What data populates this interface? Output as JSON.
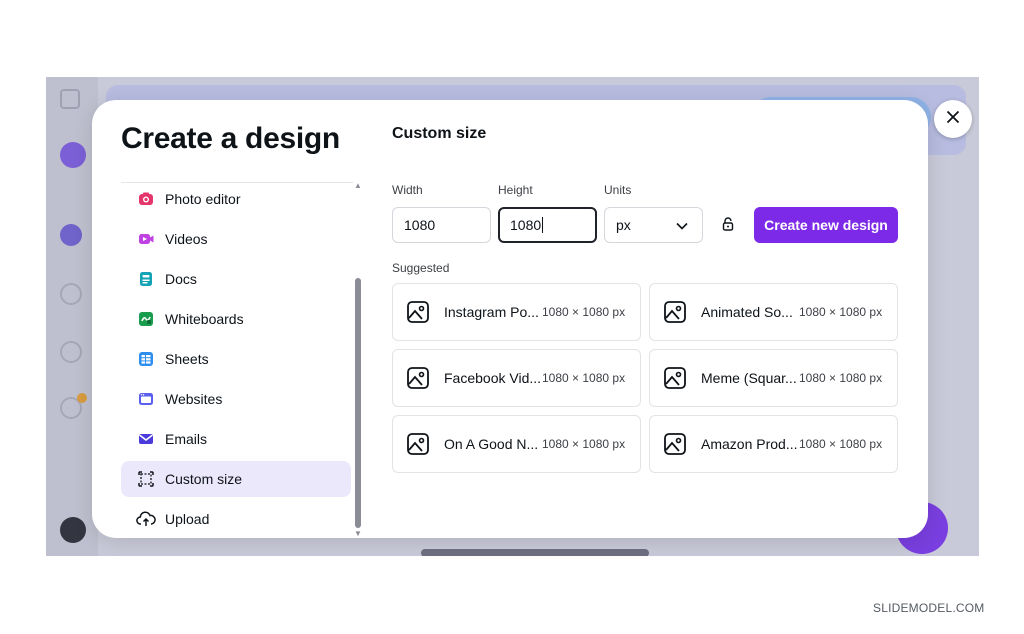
{
  "dialog": {
    "title": "Create a design",
    "close_icon": "close-icon"
  },
  "sidebar": {
    "items": [
      {
        "label": "Photo editor",
        "icon": "camera-icon",
        "color": "#e5366c"
      },
      {
        "label": "Videos",
        "icon": "video-icon",
        "color": "#c142e3"
      },
      {
        "label": "Docs",
        "icon": "doc-icon",
        "color": "#13a3b5"
      },
      {
        "label": "Whiteboards",
        "icon": "whiteboard-icon",
        "color": "#1a9c4e"
      },
      {
        "label": "Sheets",
        "icon": "sheet-icon",
        "color": "#2d8ef0"
      },
      {
        "label": "Websites",
        "icon": "website-icon",
        "color": "#5b5ff0"
      },
      {
        "label": "Emails",
        "icon": "email-icon",
        "color": "#4c3bdb"
      },
      {
        "label": "Custom size",
        "icon": "custom-size-icon",
        "color": "#0e1318",
        "active": true
      },
      {
        "label": "Upload",
        "icon": "upload-icon",
        "color": "#0e1318"
      }
    ]
  },
  "custom_size": {
    "title": "Custom size",
    "width_label": "Width",
    "width_value": "1080",
    "height_label": "Height",
    "height_value": "1080",
    "units_label": "Units",
    "units_value": "px",
    "create_button": "Create new design"
  },
  "suggested": {
    "label": "Suggested",
    "items": [
      {
        "name": "Instagram Po...",
        "size": "1080 × 1080 px"
      },
      {
        "name": "Animated So...",
        "size": "1080 × 1080 px"
      },
      {
        "name": "Facebook Vid...",
        "size": "1080 × 1080 px"
      },
      {
        "name": "Meme (Squar...",
        "size": "1080 × 1080 px"
      },
      {
        "name": "On A Good N...",
        "size": "1080 × 1080 px"
      },
      {
        "name": "Amazon Prod...",
        "size": "1080 × 1080 px"
      }
    ]
  },
  "watermark": "SLIDEMODEL.COM",
  "colors": {
    "accent": "#7d2ae8",
    "active_nav_bg": "#ece8fb"
  }
}
